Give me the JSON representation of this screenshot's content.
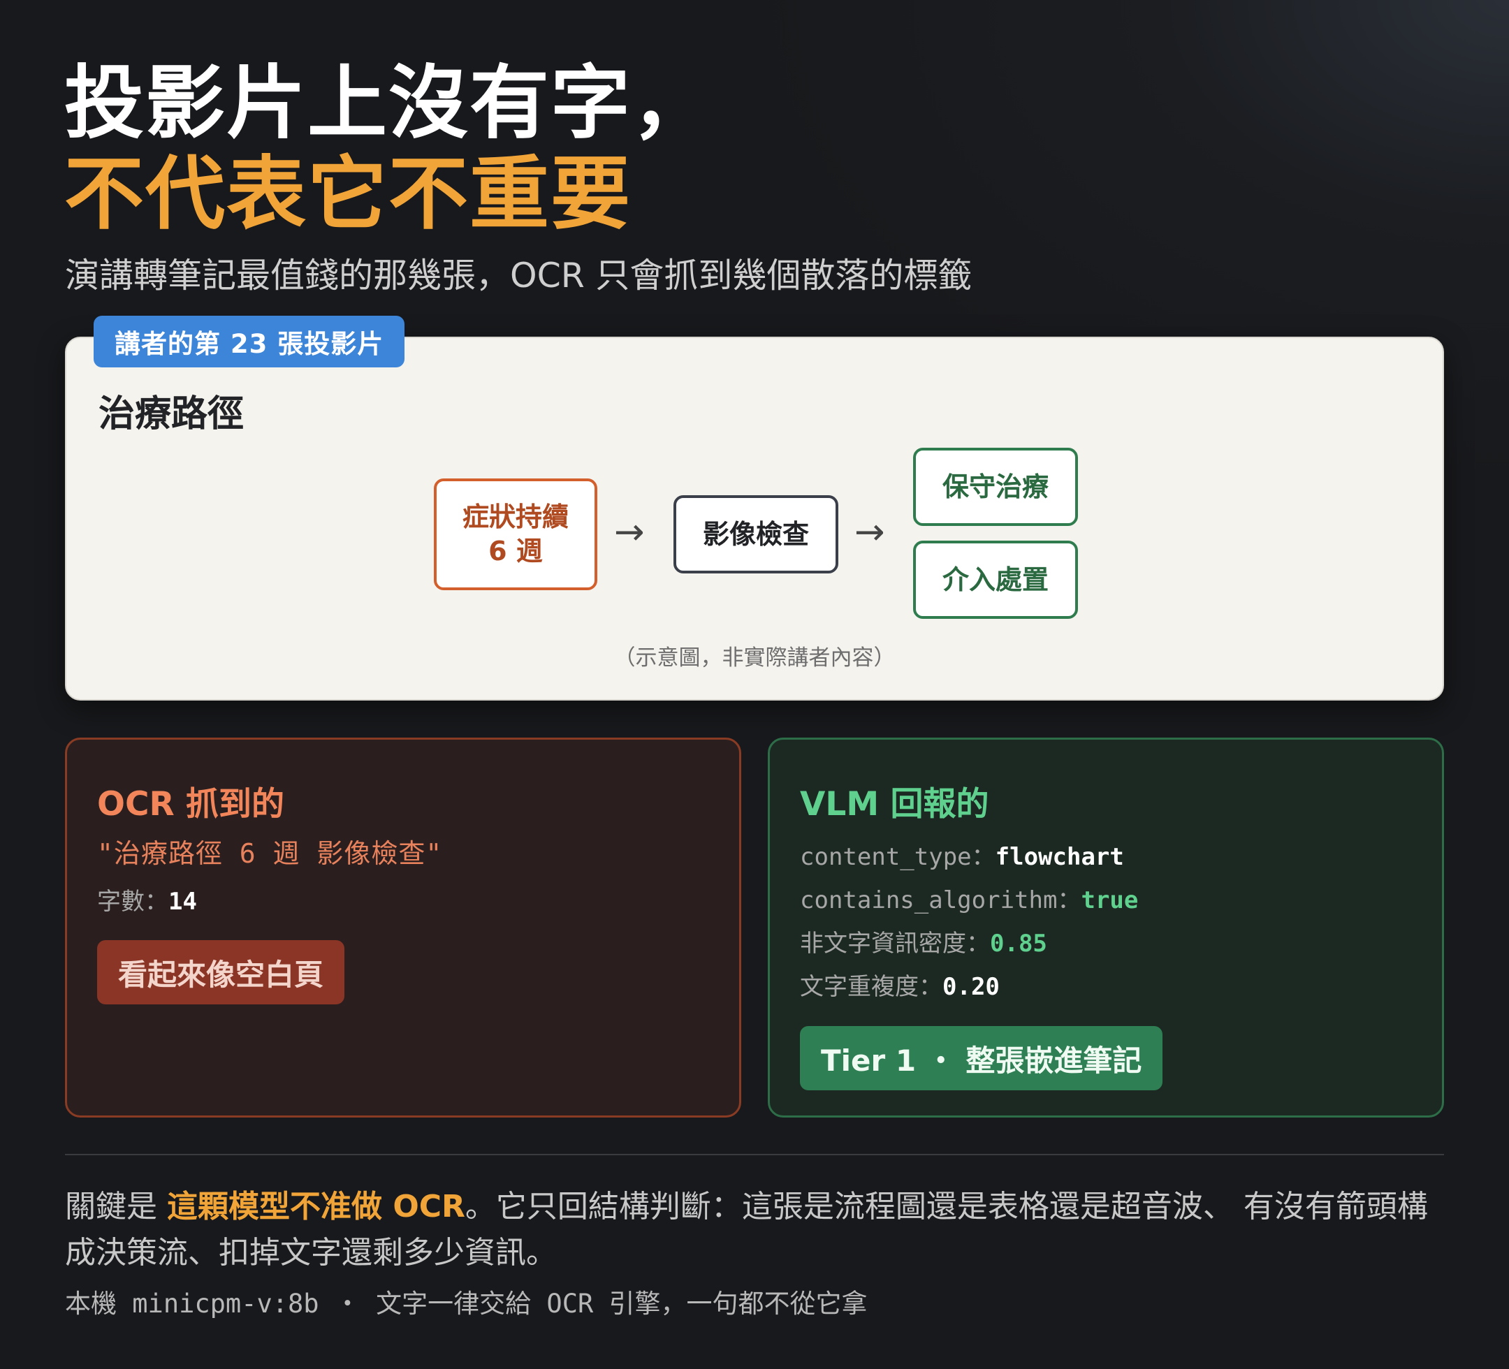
{
  "header": {
    "title_line1": "投影片上沒有字，",
    "title_line2": "不代表它不重要",
    "subtitle": "演講轉筆記最值錢的那幾張，OCR 只會抓到幾個散落的標籤"
  },
  "slide": {
    "tag": "講者的第 23 張投影片",
    "title": "治療路徑",
    "flow": {
      "box1_line1": "症狀持續",
      "box1_line2": "6 週",
      "box2": "影像檢查",
      "box3": "保守治療",
      "box4": "介入處置",
      "arrow": "→"
    },
    "note": "（示意圖，非實際講者內容）"
  },
  "ocr_panel": {
    "heading": "OCR 抓到的",
    "quote": "\"治療路徑 6 週 影像檢查\"",
    "count_label": "字數：",
    "count_value": "14",
    "badge": "看起來像空白頁"
  },
  "vlm_panel": {
    "heading": "VLM 回報的",
    "rows": [
      {
        "key": "content_type：",
        "value": "flowchart"
      },
      {
        "key": "contains_algorithm：",
        "value": "true"
      },
      {
        "key": "非文字資訊密度：",
        "value": "0.85"
      },
      {
        "key": "文字重複度：",
        "value": "0.20"
      }
    ],
    "badge": "Tier 1 ・ 整張嵌進筆記"
  },
  "footer": {
    "text_prefix": "關鍵是 ",
    "text_highlight": "這顆模型不准做 OCR",
    "text_suffix": "。它只回結構判斷：這張是流程圖還是表格還是超音波、 有沒有箭頭構成決策流、扣掉文字還剩多少資訊。",
    "note": "本機 minicpm-v:8b ・ 文字一律交給 OCR 引擎，一句都不從它拿"
  },
  "colors": {
    "accent_orange": "#f1a438",
    "tag_blue": "#3d85d8",
    "ocr_red": "#8a3526",
    "vlm_green": "#2e7f53"
  }
}
